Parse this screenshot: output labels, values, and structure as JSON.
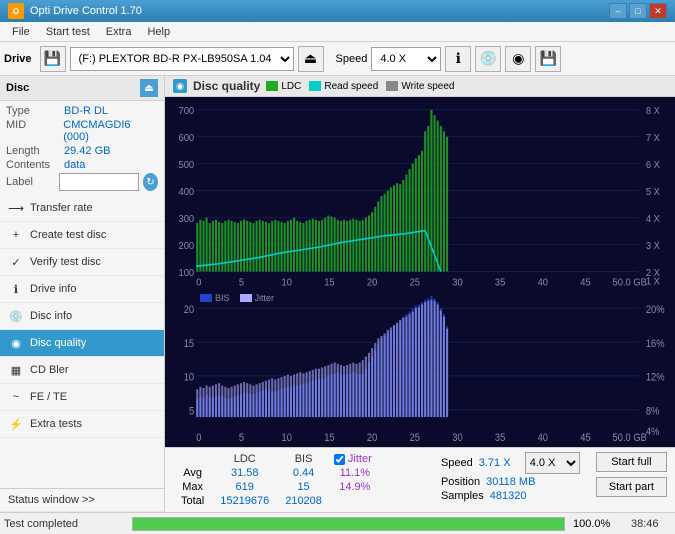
{
  "titlebar": {
    "title": "Opti Drive Control 1.70",
    "minimize": "–",
    "maximize": "□",
    "close": "✕"
  },
  "menubar": {
    "items": [
      "File",
      "Start test",
      "Extra",
      "Help"
    ]
  },
  "toolbar": {
    "drive_label": "Drive",
    "drive_value": "(F:)  PLEXTOR BD-R  PX-LB950SA 1.04",
    "speed_label": "Speed",
    "speed_value": "4.0 X"
  },
  "sidebar": {
    "disc_header": "Disc",
    "disc_info": {
      "type_label": "Type",
      "type_value": "BD-R DL",
      "mid_label": "MID",
      "mid_value": "CMCMAGDI6 (000)",
      "length_label": "Length",
      "length_value": "29.42 GB",
      "contents_label": "Contents",
      "contents_value": "data",
      "label_label": "Label"
    },
    "nav_items": [
      {
        "id": "transfer-rate",
        "label": "Transfer rate",
        "icon": "⟶"
      },
      {
        "id": "create-test-disc",
        "label": "Create test disc",
        "icon": "+"
      },
      {
        "id": "verify-test-disc",
        "label": "Verify test disc",
        "icon": "✓"
      },
      {
        "id": "drive-info",
        "label": "Drive info",
        "icon": "ℹ"
      },
      {
        "id": "disc-info",
        "label": "Disc info",
        "icon": "💿"
      },
      {
        "id": "disc-quality",
        "label": "Disc quality",
        "icon": "◉",
        "active": true
      },
      {
        "id": "cd-bler",
        "label": "CD Bler",
        "icon": "▦"
      },
      {
        "id": "fe-te",
        "label": "FE / TE",
        "icon": "~"
      },
      {
        "id": "extra-tests",
        "label": "Extra tests",
        "icon": "⚡"
      }
    ],
    "status_window": "Status window >>"
  },
  "chart": {
    "title": "Disc quality",
    "legend": {
      "ldc": "LDC",
      "read_speed": "Read speed",
      "write_speed": "Write speed",
      "bis": "BIS",
      "jitter": "Jitter"
    },
    "upper": {
      "y_max": 700,
      "y_axis": [
        700,
        600,
        500,
        400,
        300,
        200,
        100
      ],
      "x_axis": [
        0,
        5,
        10,
        15,
        20,
        25,
        30,
        35,
        40,
        45,
        "50.0 GB"
      ],
      "right_axis": [
        "8 X",
        "7 X",
        "6 X",
        "5 X",
        "4 X",
        "3 X",
        "2 X",
        "1 X"
      ]
    },
    "lower": {
      "y_max": 20,
      "y_axis": [
        20,
        15,
        10,
        5
      ],
      "x_axis": [
        0,
        5,
        10,
        15,
        20,
        25,
        30,
        35,
        40,
        45,
        "50.0 GB"
      ],
      "right_axis": [
        "20%",
        "16%",
        "12%",
        "8%",
        "4%"
      ]
    }
  },
  "stats": {
    "headers": [
      "LDC",
      "BIS"
    ],
    "jitter_label": "Jitter",
    "jitter_checked": true,
    "avg_label": "Avg",
    "avg_ldc": "31.58",
    "avg_bis": "0.44",
    "avg_jitter": "11.1%",
    "max_label": "Max",
    "max_ldc": "619",
    "max_bis": "15",
    "max_jitter": "14.9%",
    "total_label": "Total",
    "total_ldc": "15219676",
    "total_bis": "210208",
    "speed_label": "Speed",
    "speed_val": "3.71 X",
    "speed_select": "4.0 X",
    "position_label": "Position",
    "position_val": "30118 MB",
    "samples_label": "Samples",
    "samples_val": "481320",
    "btn_full": "Start full",
    "btn_part": "Start part"
  },
  "statusbar": {
    "text": "Test completed",
    "progress": 100,
    "progress_text": "100.0%",
    "time": "38:46"
  },
  "colors": {
    "ldc": "#22aa22",
    "read_speed": "#00cccc",
    "write_speed": "#888888",
    "bis": "#2244cc",
    "jitter": "#aaaaff",
    "accent": "#3399cc"
  }
}
